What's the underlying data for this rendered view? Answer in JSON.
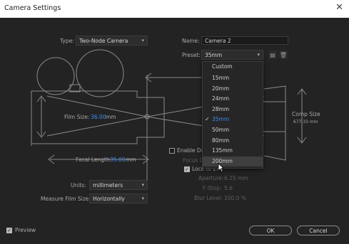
{
  "window": {
    "title": "Camera Settings"
  },
  "type": {
    "label": "Type:",
    "value": "Two-Node Camera"
  },
  "name": {
    "label": "Name:",
    "value": "Camera 2"
  },
  "preset": {
    "label": "Preset:",
    "value": "35mm",
    "options": [
      "Custom",
      "15mm",
      "20mm",
      "24mm",
      "28mm",
      "35mm",
      "50mm",
      "80mm",
      "135mm",
      "200mm"
    ],
    "selected": "35mm",
    "hovered": "200mm"
  },
  "film_size": {
    "label": "Film Size:",
    "value": "36.00",
    "unit": "mm"
  },
  "focal_length": {
    "label": "Focal Length:",
    "value": "35.00",
    "unit": "mm"
  },
  "comp_size": {
    "label": "Comp Size",
    "value": "677.33 mm"
  },
  "enable_dof": {
    "label": "Enable De"
  },
  "focus_distance": {
    "label": "Focus D"
  },
  "lock_zoom": {
    "label": "Lock to Zoo",
    "checked": true
  },
  "aperture": {
    "label": "Aperture:",
    "value": "6.25 mm"
  },
  "fstop": {
    "label": "F-Stop:",
    "value": "5.6"
  },
  "blur_level": {
    "label": "Blur Level:",
    "value": "100.0 %"
  },
  "units": {
    "label": "Units:",
    "value": "millimeters"
  },
  "measure_film": {
    "label": "Measure Film Size:",
    "value": "Horizontally"
  },
  "preview": {
    "label": "Preview",
    "checked": true
  },
  "buttons": {
    "ok": "OK",
    "cancel": "Cancel"
  },
  "icons": {
    "close": "close-icon",
    "save_preset": "save-preset-icon",
    "delete_preset": "trash-icon"
  }
}
